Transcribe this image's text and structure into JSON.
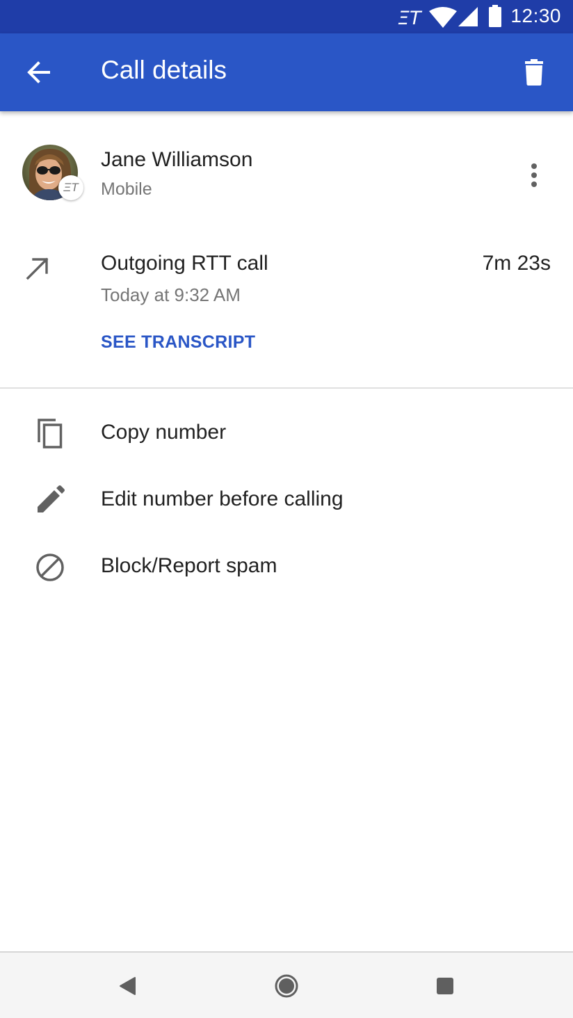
{
  "status_bar": {
    "time": "12:30",
    "rtt_indicator": "ΞT",
    "icons": [
      "rtt-icon",
      "wifi-icon",
      "cellular-signal-icon",
      "battery-icon"
    ],
    "background_color": "#1f3da8"
  },
  "app_bar": {
    "title": "Call details",
    "background_color": "#2a56c6",
    "back_icon": "arrow-back-icon",
    "delete_icon": "trash-icon"
  },
  "contact": {
    "name": "Jane Williamson",
    "number_type": "Mobile",
    "rtt_badge": "ΞT",
    "menu_icon": "more-vertical-icon"
  },
  "call": {
    "type": "Outgoing RTT call",
    "duration": "7m 23s",
    "time": "Today at 9:32 AM",
    "transcript_label": "SEE TRANSCRIPT",
    "direction_icon": "outgoing-arrow-icon",
    "accent_color": "#2a56c6"
  },
  "actions": [
    {
      "label": "Copy number",
      "icon": "copy-icon"
    },
    {
      "label": "Edit number before calling",
      "icon": "pencil-icon"
    },
    {
      "label": "Block/Report spam",
      "icon": "block-icon"
    }
  ],
  "nav_bar": {
    "icons": [
      "nav-back-icon",
      "nav-home-icon",
      "nav-recents-icon"
    ]
  }
}
